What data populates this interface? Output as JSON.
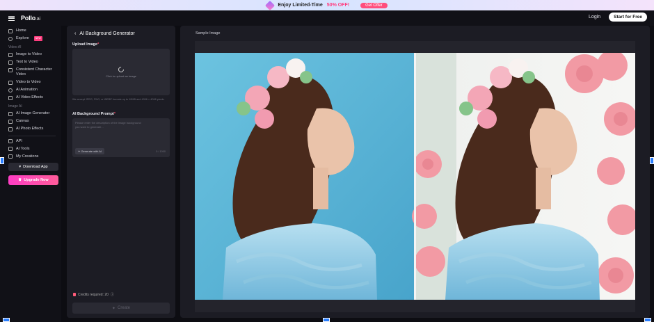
{
  "promo": {
    "text_prefix": "Enjoy Limited-Time",
    "text_off": "50% OFF!",
    "offer_button": "Get Offer"
  },
  "header": {
    "logo": "Pollo",
    "logo_suffix": ".ai",
    "login": "Login",
    "start_button": "Start for Free"
  },
  "sidebar": {
    "home": "Home",
    "explore": "Explore",
    "explore_badge": "NEW",
    "section_video": "Video AI",
    "image_to_video": "Image to Video",
    "text_to_video": "Text to Video",
    "consistent_character": "Consistent Character Video",
    "video_to_video": "Video to Video",
    "ai_animation": "AI Animation",
    "ai_video_effects": "AI Video Effects",
    "section_image": "Image AI",
    "ai_image_generator": "AI Image Generator",
    "canvas": "Canvas",
    "ai_photo_effects": "AI Photo Effects",
    "api": "API",
    "ai_tools": "AI Tools",
    "my_creations": "My Creations",
    "download_app": "Download App",
    "upgrade_now": "Upgrade Now"
  },
  "panel": {
    "title": "AI Background Generator",
    "upload_label": "Upload Image",
    "upload_hint": "Click to upload an image",
    "format_note": "We accept JPEG, PNG, or WEBP formats up to 10MB and 4096 × 4096 pixels.",
    "prompt_label": "AI Background Prompt",
    "prompt_placeholder": "Please enter the description of the image background you want to generate...",
    "generate_with_ai": "Generate with AI",
    "char_count": "0 / 1000",
    "credits": "Credits required: 20",
    "create_button": "Create"
  },
  "preview": {
    "label": "Sample Image"
  },
  "colors": {
    "accent_pink": "#ff3d7f",
    "sky_blue": "#5ab4d6",
    "rose": "#f2a4ad"
  }
}
